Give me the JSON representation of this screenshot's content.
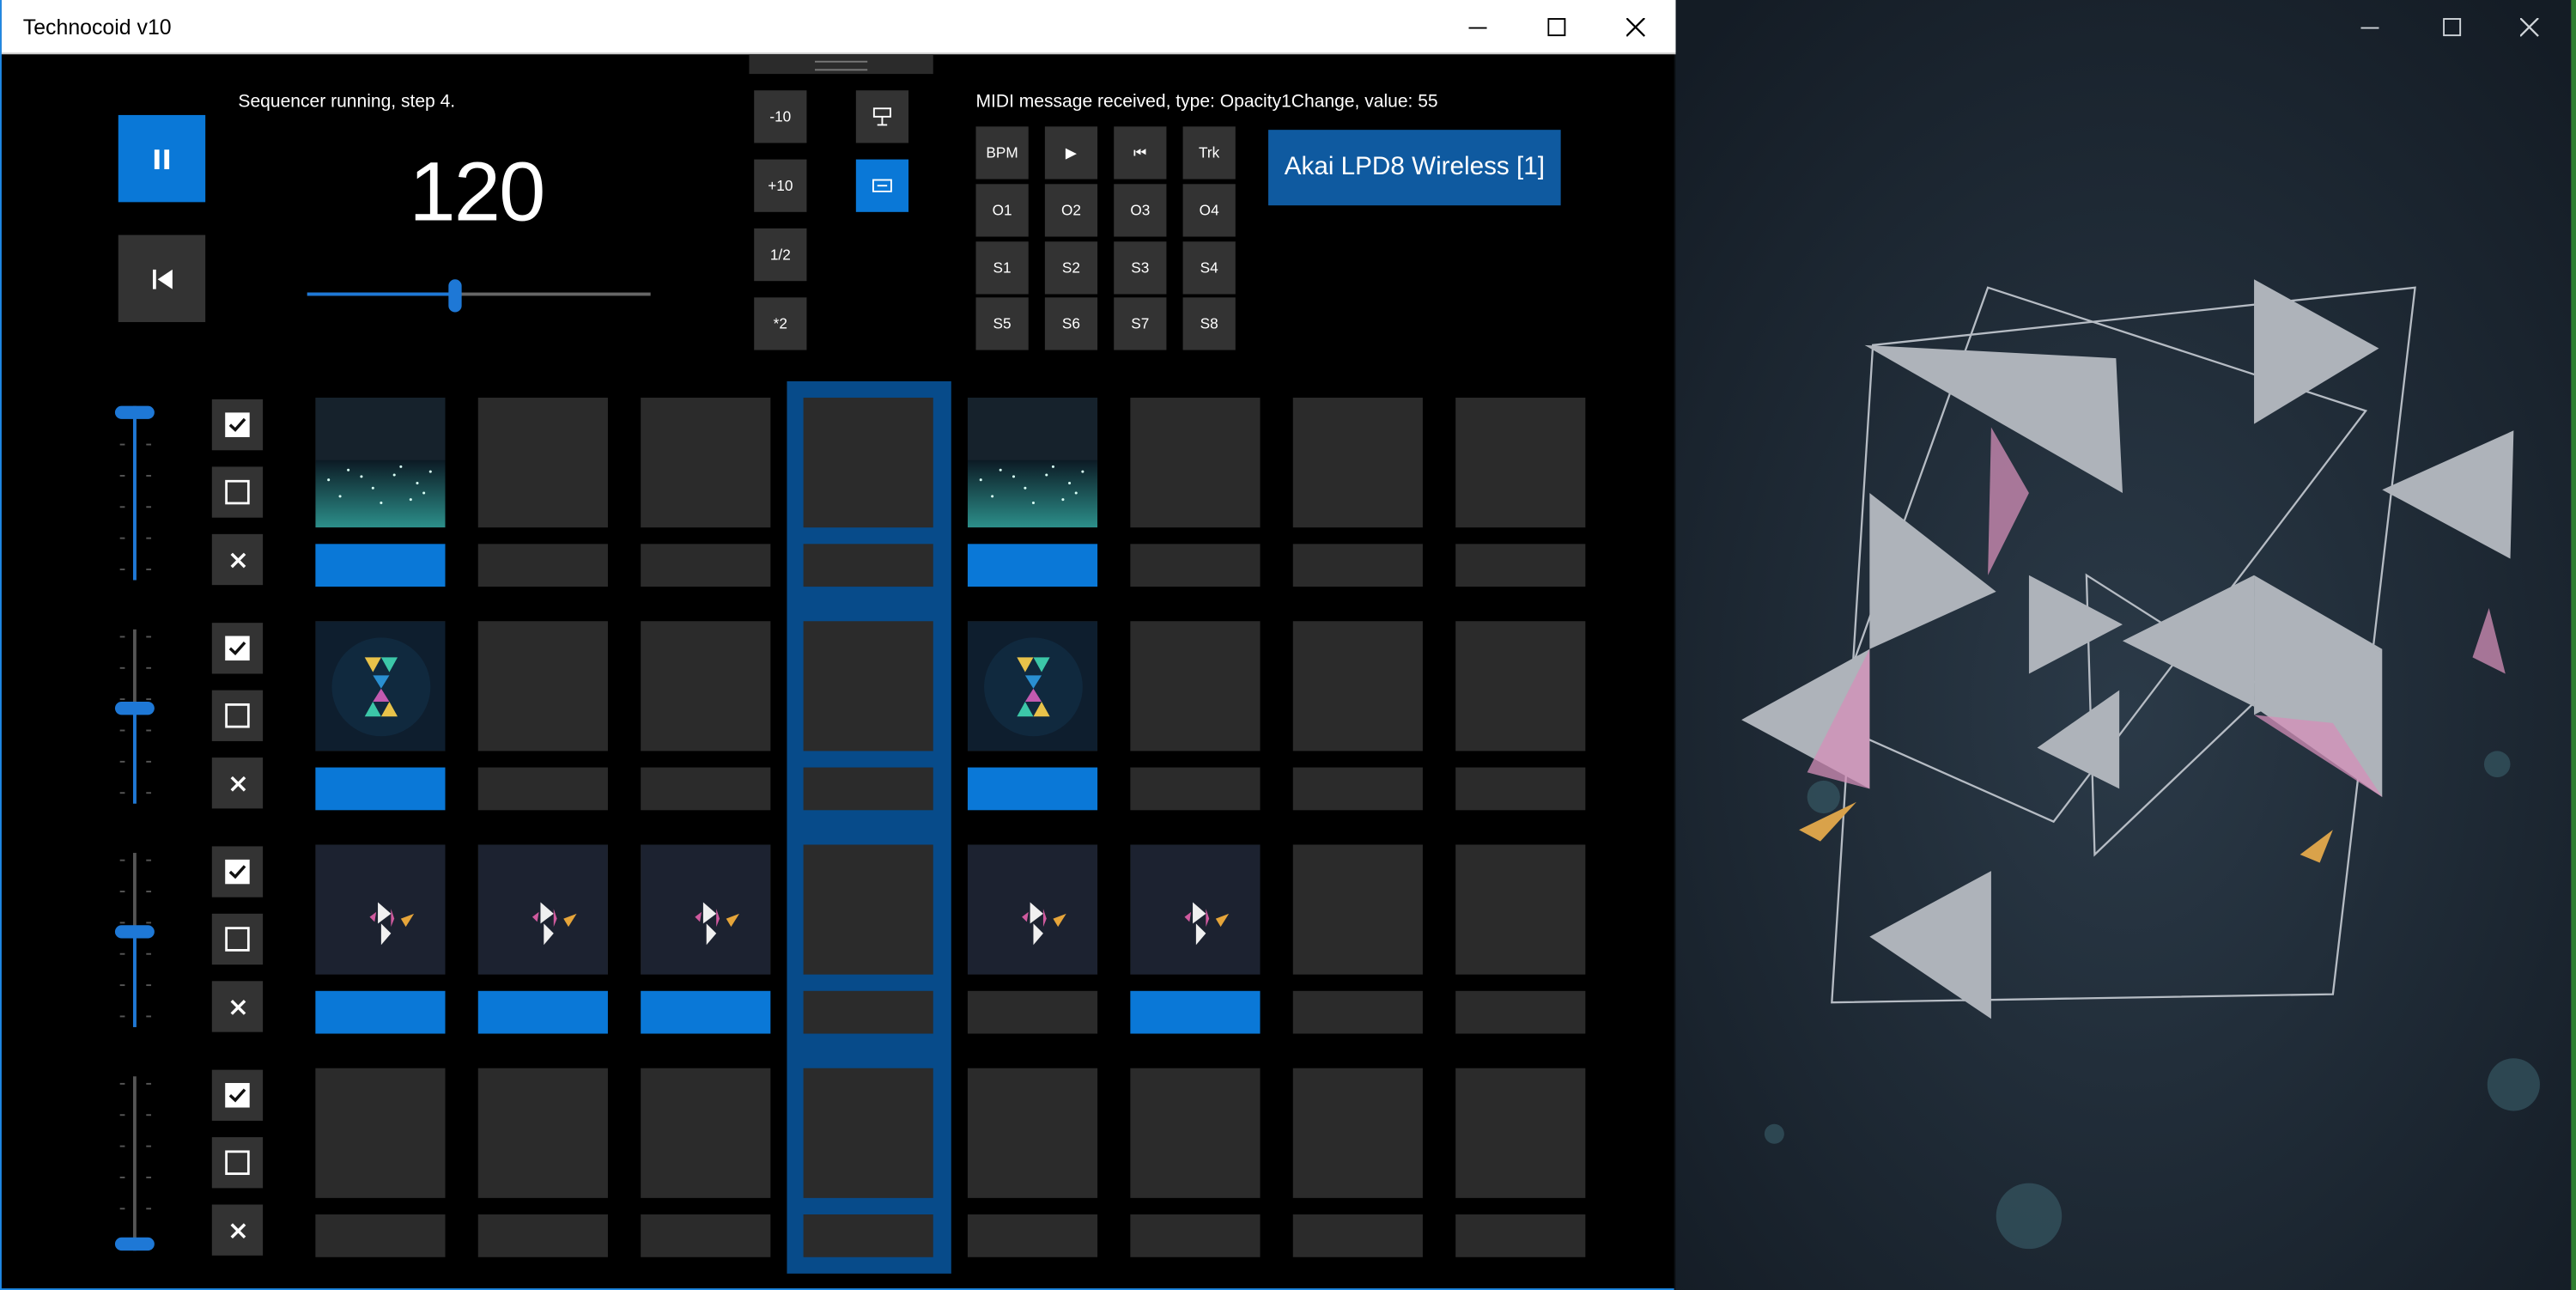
{
  "main_window": {
    "title": "Technocoid v10",
    "status_text": "Sequencer running, step 4.",
    "bpm": "120",
    "bpm_slider_fraction": 0.43,
    "step_buttons": [
      "-10",
      "+10",
      "1/2",
      "*2"
    ],
    "midi_status": "MIDI message received, type: Opacity1Change, value: 55",
    "midi_buttons": [
      [
        "BPM",
        "▶",
        "⏮",
        "Trk"
      ],
      [
        "O1",
        "O2",
        "O3",
        "O4"
      ],
      [
        "S1",
        "S2",
        "S3",
        "S4"
      ],
      [
        "S5",
        "S6",
        "S7",
        "S8"
      ]
    ],
    "device_name": "Akai LPD8 Wireless [1]",
    "current_step": 4,
    "colors": {
      "accent": "#0a78d7",
      "highlight": "#074b8a",
      "cell": "#2b2b2b"
    },
    "tracks": [
      {
        "opacity": 1.0,
        "thumb": "starfield-image",
        "steps": [
          1,
          0,
          0,
          0,
          1,
          0,
          0,
          0
        ],
        "thumbs": [
          1,
          0,
          0,
          0,
          1,
          0,
          0,
          0
        ]
      },
      {
        "opacity": 0.55,
        "thumb": "hourglass-triangles-image",
        "steps": [
          1,
          0,
          0,
          0,
          1,
          0,
          0,
          0
        ],
        "thumbs": [
          1,
          0,
          0,
          0,
          1,
          0,
          0,
          0
        ]
      },
      {
        "opacity": 0.55,
        "thumb": "triangle-figure-image",
        "steps": [
          1,
          1,
          1,
          0,
          0,
          1,
          0,
          0
        ],
        "thumbs": [
          1,
          1,
          1,
          0,
          1,
          1,
          0,
          0
        ]
      },
      {
        "opacity": 0.0,
        "thumb": "",
        "steps": [
          0,
          0,
          0,
          0,
          0,
          0,
          0,
          0
        ],
        "thumbs": [
          0,
          0,
          0,
          0,
          0,
          0,
          0,
          0
        ]
      }
    ]
  },
  "output_window": {
    "visual": "geometric-triangles-render"
  }
}
